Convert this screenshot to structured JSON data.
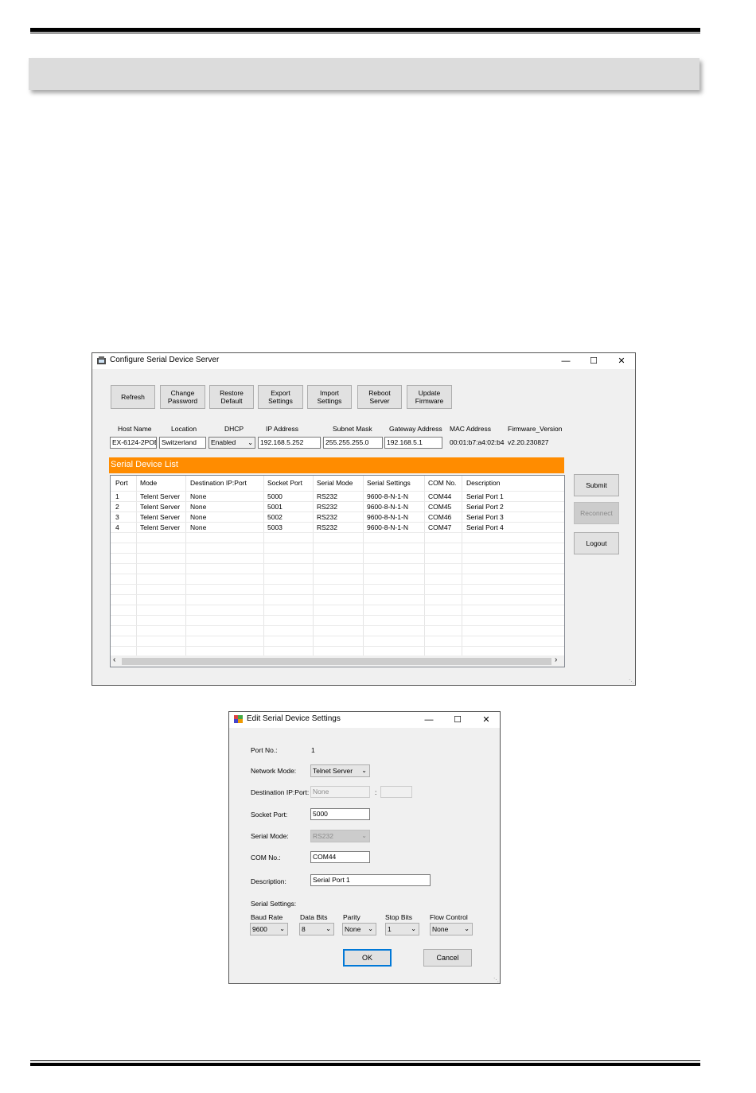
{
  "main_window": {
    "title": "Configure Serial Device Server",
    "toolbar": [
      {
        "label": "Refresh"
      },
      {
        "label": "Change Password"
      },
      {
        "label": "Restore Default"
      },
      {
        "label": "Export Settings"
      },
      {
        "label": "Import Settings"
      },
      {
        "label": "Reboot Server"
      },
      {
        "label": "Update Firmware"
      }
    ],
    "fields": {
      "host_name_label": "Host Name",
      "host_name": "EX-6124-2POE",
      "location_label": "Location",
      "location": "Switzerland",
      "dhcp_label": "DHCP",
      "dhcp": "Enabled",
      "ip_label": "IP Address",
      "ip": "192.168.5.252",
      "subnet_label": "Subnet Mask",
      "subnet": "255.255.255.0",
      "gateway_label": "Gateway Address",
      "gateway": "192.168.5.1",
      "mac_label": "MAC Address",
      "mac": "00:01:b7:a4:02:b4",
      "firmware_label": "Firmware_Version",
      "firmware": "v2.20.230827"
    },
    "list_title": "Serial Device List",
    "columns": [
      "Port",
      "Mode",
      "Destination IP:Port",
      "Socket Port",
      "Serial Mode",
      "Serial Settings",
      "COM No.",
      "Description"
    ],
    "rows": [
      [
        "1",
        "Telent Server",
        "None",
        "5000",
        "RS232",
        "9600-8-N-1-N",
        "COM44",
        "Serial Port 1"
      ],
      [
        "2",
        "Telent Server",
        "None",
        "5001",
        "RS232",
        "9600-8-N-1-N",
        "COM45",
        "Serial Port 2"
      ],
      [
        "3",
        "Telent Server",
        "None",
        "5002",
        "RS232",
        "9600-8-N-1-N",
        "COM46",
        "Serial Port 3"
      ],
      [
        "4",
        "Telent Server",
        "None",
        "5003",
        "RS232",
        "9600-8-N-1-N",
        "COM47",
        "Serial Port 4"
      ]
    ],
    "side_buttons": {
      "submit": "Submit",
      "reconnect": "Reconnect",
      "logout": "Logout"
    }
  },
  "edit_window": {
    "title": "Edit Serial Device Settings",
    "port_no_label": "Port No.:",
    "port_no": "1",
    "network_mode_label": "Network Mode:",
    "network_mode": "Telnet Server",
    "dest_label": "Destination IP:Port:",
    "dest_ip": "None",
    "dest_sep": ":",
    "dest_port": "",
    "socket_port_label": "Socket Port:",
    "socket_port": "5000",
    "serial_mode_label": "Serial Mode:",
    "serial_mode": "RS232",
    "com_no_label": "COM No.:",
    "com_no": "COM44",
    "description_label": "Description:",
    "description": "Serial Port 1",
    "serial_settings_label": "Serial Settings:",
    "baud_label": "Baud Rate",
    "baud": "9600",
    "data_bits_label": "Data Bits",
    "data_bits": "8",
    "parity_label": "Parity",
    "parity": "None",
    "stop_bits_label": "Stop Bits",
    "stop_bits": "1",
    "flow_label": "Flow Control",
    "flow": "None",
    "ok": "OK",
    "cancel": "Cancel"
  },
  "icons": [
    "window-icon",
    "minimize-icon",
    "maximize-icon",
    "close-icon",
    "chevron-down-icon",
    "scroll-left-icon",
    "scroll-right-icon",
    "resize-grip-icon"
  ]
}
